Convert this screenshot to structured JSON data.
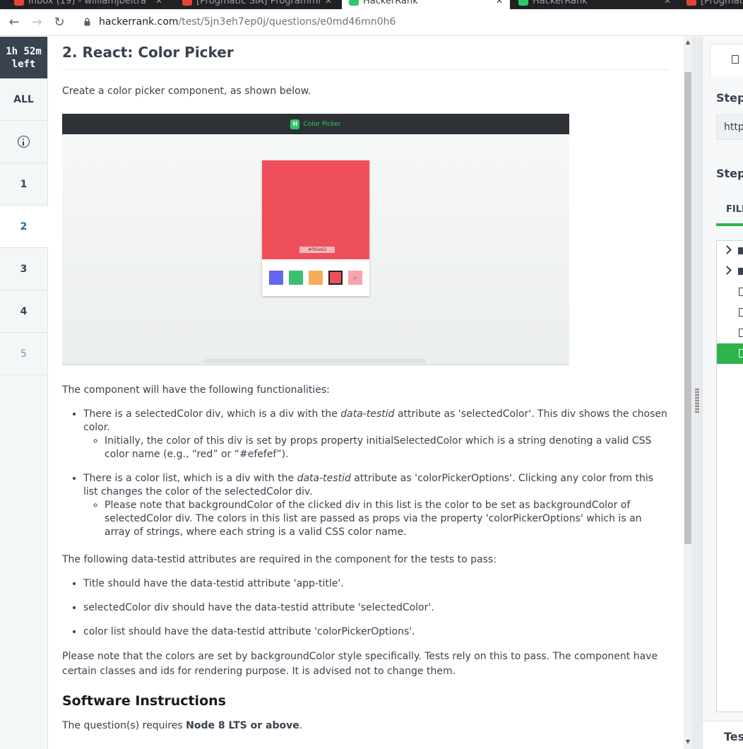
{
  "browser": {
    "tabs": [
      {
        "title": "Inbox (19) - williamjbeltra",
        "active": false,
        "favicon_color": "#ea4335"
      },
      {
        "title": "[Progmatic SIA] Programmi",
        "active": false,
        "favicon_color": "#ea4335"
      },
      {
        "title": "HackerRank",
        "active": true,
        "favicon_color": "#2ec866"
      },
      {
        "title": "HackerRank",
        "active": false,
        "favicon_color": "#2ec866"
      },
      {
        "title": "[Progmatic",
        "active": false,
        "favicon_color": "#ea4335"
      }
    ],
    "url_host": "hackerrank.com",
    "url_path": "/test/5jn3eh7ep0j/questions/e0md46mn0h6",
    "back_icon": "arrow-left-icon",
    "forward_icon": "arrow-right-icon",
    "reload_icon": "reload-icon"
  },
  "leftnav": {
    "timer_line1": "1h 52m",
    "timer_line2": "left",
    "all_label": "ALL",
    "info_icon": "info-icon",
    "questions": [
      "1",
      "2",
      "3",
      "4",
      "5"
    ],
    "active_question": "2"
  },
  "question": {
    "title": "2. React: Color Picker",
    "intro": "Create a color picker component, as shown below.",
    "preview": {
      "app_logo": "H",
      "app_title": "Color Picker",
      "hex_label": "#f95e62",
      "selected_color": "#ef4f5a",
      "swatches": [
        "#6366f1",
        "#38c172",
        "#f6ad55",
        "#ef4f5a",
        "#f6a5ae"
      ]
    },
    "functionalities_heading": "The component will have the following functionalities:",
    "bullet1_pre": "There is a selectedColor div, which is a div with the ",
    "bullet1_em": "data-testid",
    "bullet1_post": " attribute as 'selectedColor'. This div shows the chosen color.",
    "bullet1_sub": "Initially, the color of this div is set by props property initialSelectedColor which is a string denoting a valid CSS color name (e.g., “red” or “#efefef”).",
    "bullet2_pre": "There is a color list, which is a div with the ",
    "bullet2_em": "data-testid",
    "bullet2_post": " attribute as 'colorPickerOptions'.  Clicking any color from this list changes the color of the selectedColor div.",
    "bullet2_sub": "Please note that backgroundColor of the clicked div in this list is the color to be set as backgroundColor of selectedColor div.  The colors in this list are passed as props via the property 'colorPickerOptions' which is an array of strings, where each string is a valid CSS color name.",
    "testid_heading": "The following data-testid attributes are required in the component for the tests to pass:",
    "testid_items": [
      "Title should have the data-testid attribute 'app-title'.",
      "selectedColor div should have the data-testid attribute 'selectedColor'.",
      "color list should have the data-testid attribute 'colorPickerOptions'."
    ],
    "note": "Please note that the colors are set by backgroundColor style specifically. Tests rely on this to pass. The component have certain classes and ids for rendering purpose. It is advised not to change them.",
    "software_heading": "Software Instructions",
    "requires_pre": "The question(s) requires ",
    "requires_bold": "Node 8 LTS or above",
    "requires_post": "."
  },
  "right_panel": {
    "step1": "Step",
    "input_value": "https",
    "step2": "Step",
    "files_tab": "FILE",
    "tests_label": "Tes"
  },
  "colors": {
    "accent_green": "#2eb44b",
    "timer_bg": "#39424e",
    "active_question": "#1f6f9f"
  }
}
